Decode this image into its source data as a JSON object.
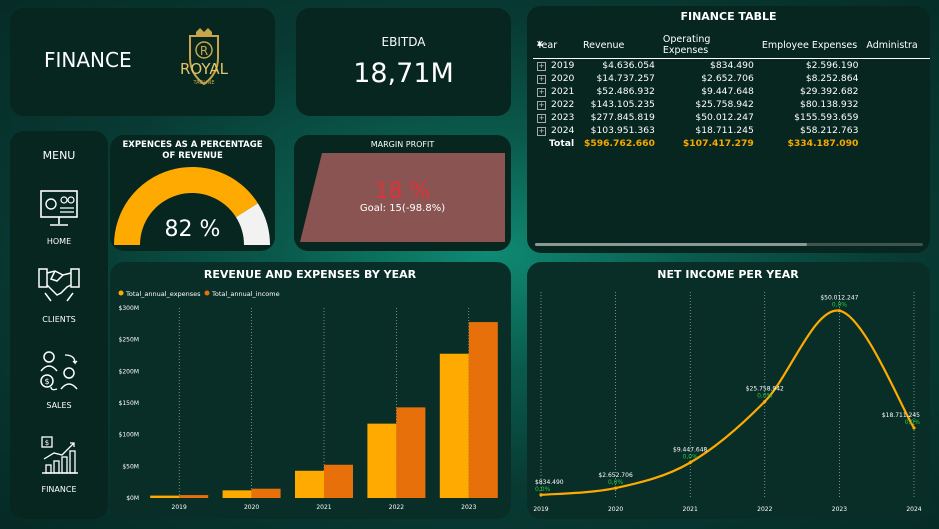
{
  "header": {
    "title": "FINANCE",
    "logo_text": "ROYAL",
    "logo_tagline": "TAGLINE",
    "logo_letter": "R"
  },
  "ebitda": {
    "label": "EBITDA",
    "value": "18,71M"
  },
  "menu": {
    "title": "MENU",
    "items": [
      {
        "label": "HOME",
        "icon": "dashboard-icon"
      },
      {
        "label": "CLIENTS",
        "icon": "handshake-icon"
      },
      {
        "label": "SALES",
        "icon": "sales-exchange-icon"
      },
      {
        "label": "FINANCE",
        "icon": "finance-chart-icon"
      }
    ]
  },
  "expenses_gauge": {
    "title": "EXPENCES AS A PERCENTAGE OF REVENUE",
    "value_label": "82 %",
    "value": 82,
    "color": "#ffaa00"
  },
  "margin_profit": {
    "title": "MARGIN PROFIT",
    "value_label": "18 %",
    "goal_label": "Goal: 15(-98.8%)"
  },
  "finance_table": {
    "title": "FINANCE TABLE",
    "columns": [
      "Year",
      "Revenue",
      "Operating Expenses",
      "Employee Expenses",
      "Administra"
    ],
    "rows": [
      {
        "year": "2019",
        "revenue": "$4.636.054",
        "opex": "$834.490",
        "empx": "$2.596.190"
      },
      {
        "year": "2020",
        "revenue": "$14.737.257",
        "opex": "$2.652.706",
        "empx": "$8.252.864"
      },
      {
        "year": "2021",
        "revenue": "$52.486.932",
        "opex": "$9.447.648",
        "empx": "$29.392.682"
      },
      {
        "year": "2022",
        "revenue": "$143.105.235",
        "opex": "$25.758.942",
        "empx": "$80.138.932"
      },
      {
        "year": "2023",
        "revenue": "$277.845.819",
        "opex": "$50.012.247",
        "empx": "$155.593.659"
      },
      {
        "year": "2024",
        "revenue": "$103.951.363",
        "opex": "$18.711.245",
        "empx": "$58.212.763"
      }
    ],
    "total": {
      "label": "Total",
      "revenue": "$596.762.660",
      "opex": "$107.417.279",
      "empx": "$334.187.090"
    }
  },
  "chart_data": [
    {
      "type": "bar",
      "title": "REVENUE AND EXPENSES BY YEAR",
      "categories": [
        "2019",
        "2020",
        "2021",
        "2022",
        "2023"
      ],
      "series": [
        {
          "name": "Total_annual_expenses",
          "color": "#ffaa00",
          "values": [
            3.8,
            12.1,
            43.0,
            117.4,
            227.8
          ]
        },
        {
          "name": "Total_annual_income",
          "color": "#e8700a",
          "values": [
            4.6,
            14.7,
            52.5,
            143.1,
            277.8
          ]
        }
      ],
      "y_ticks": [
        "$0M",
        "$50M",
        "$100M",
        "$150M",
        "$200M",
        "$250M",
        "$300M"
      ],
      "ylim": [
        0,
        300
      ],
      "legend": "top-left"
    },
    {
      "type": "line",
      "title": "NET INCOME PER YEAR",
      "x": [
        "2019",
        "2020",
        "2021",
        "2022",
        "2023",
        "2024"
      ],
      "values": [
        0.83449,
        2.652706,
        9.447648,
        25.758942,
        50.012247,
        18.711245
      ],
      "point_labels": [
        "$834.490",
        "$2.652.706",
        "$9.447.648",
        "$25.758.942",
        "$50.012.247",
        "$18.711.245"
      ],
      "pct_labels": [
        "0,0%",
        "0,0%",
        "0,0%",
        "0,0%",
        "0,0%",
        "0,0%"
      ],
      "ylim": [
        0,
        55
      ],
      "color": "#ffaa00"
    }
  ]
}
